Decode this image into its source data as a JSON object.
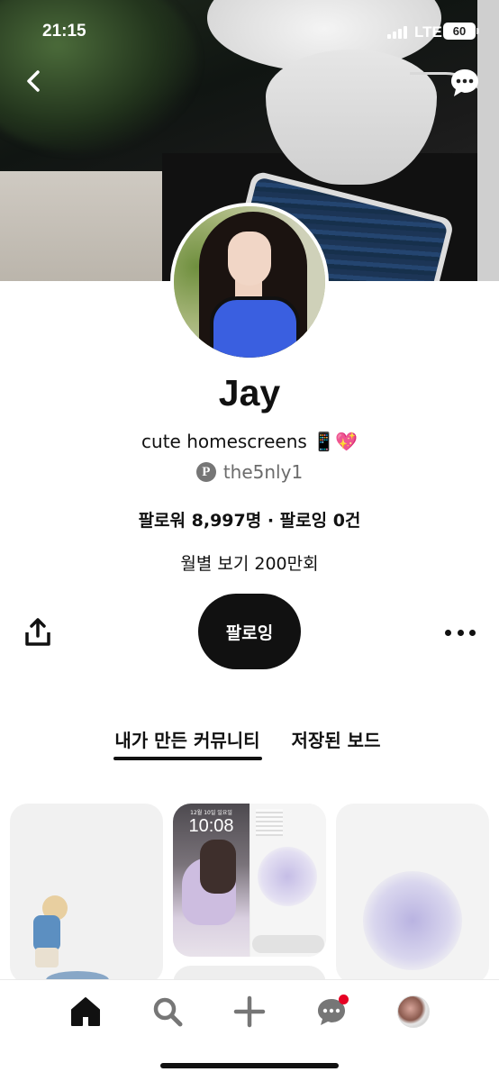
{
  "status_bar": {
    "time": "21:15",
    "network": "LTE",
    "battery": "60"
  },
  "profile": {
    "name": "Jay",
    "bio": "cute homescreens 📱💖",
    "handle": "the5nly1",
    "stats": "팔로워 8,997명 · 팔로잉 0건",
    "monthly_views": "월별 보기 200만회"
  },
  "actions": {
    "follow_label": "팔로잉"
  },
  "tabs": [
    {
      "label": "내가 만든 커뮤니티",
      "active": true
    },
    {
      "label": "저장된 보드",
      "active": false
    }
  ],
  "pins": {
    "lockscreen_date": "12월 10일 일요일",
    "lockscreen_time": "10:08"
  },
  "icons": {
    "back": "chevron-left-icon",
    "chat": "chat-bubble-icon",
    "share": "share-icon",
    "more": "more-horizontal-icon",
    "pinterest": "pinterest-logo-icon",
    "home": "home-icon",
    "search": "search-icon",
    "create": "plus-icon",
    "messages": "messages-icon",
    "profile": "avatar"
  },
  "colors": {
    "accent": "#111111",
    "notification": "#e60023",
    "secondary_text": "#6b6b6b"
  }
}
